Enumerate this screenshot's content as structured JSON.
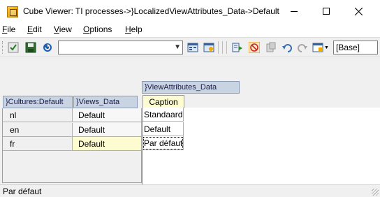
{
  "window": {
    "title": "Cube Viewer: TI processes->}LocalizedViewAttributes_Data->Default"
  },
  "menu": [
    {
      "label": "File",
      "accel": "F",
      "rest": "ile"
    },
    {
      "label": "Edit",
      "accel": "E",
      "rest": "dit"
    },
    {
      "label": "View",
      "accel": "V",
      "rest": "iew"
    },
    {
      "label": "Options",
      "accel": "O",
      "rest": "ptions"
    },
    {
      "label": "Help",
      "accel": "H",
      "rest": "elp"
    }
  ],
  "toolbar": {
    "view_select_value": "",
    "base_label": "[Base]"
  },
  "cube": {
    "column_dimension": "}ViewAttributes_Data",
    "column_header": "Caption",
    "row_dimensions": [
      "}Cultures:Default",
      "}Views_Data"
    ],
    "rows": [
      {
        "culture": "nl",
        "view": "Default",
        "caption": "Standaard"
      },
      {
        "culture": "en",
        "view": "Default",
        "caption": "Default"
      },
      {
        "culture": "fr",
        "view": "Default",
        "caption": "Par défaut"
      }
    ]
  },
  "status": {
    "text": "Par défaut"
  }
}
